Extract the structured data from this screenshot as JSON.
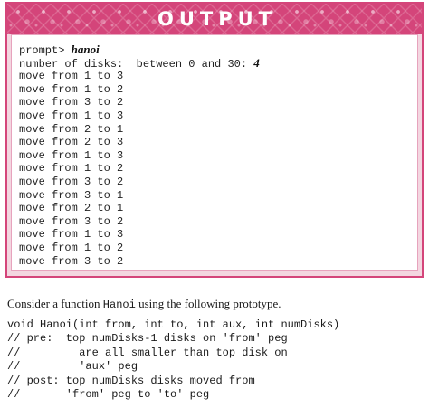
{
  "output": {
    "title": "OUTPUT",
    "prompt_line": {
      "prompt": "prompt> ",
      "command": "hanoi"
    },
    "disks_line": {
      "label": "number of disks:  between 0 and 30: ",
      "value": "4"
    },
    "moves": [
      "move from 1 to 3",
      "move from 1 to 2",
      "move from 3 to 2",
      "move from 1 to 3",
      "move from 2 to 1",
      "move from 2 to 3",
      "move from 1 to 3",
      "move from 1 to 2",
      "move from 3 to 2",
      "move from 3 to 1",
      "move from 2 to 1",
      "move from 3 to 2",
      "move from 1 to 3",
      "move from 1 to 2",
      "move from 3 to 2"
    ],
    "colors": {
      "frame": "#d4457a",
      "frame_tint": "#f3d6e0",
      "title_text": "#ffffff"
    }
  },
  "description": {
    "before": "Consider a function ",
    "function_name": "Hanoi",
    "after": " using the following prototype."
  },
  "code": [
    "void Hanoi(int from, int to, int aux, int numDisks)",
    "// pre:  top numDisks-1 disks on 'from' peg",
    "//         are all smaller than top disk on",
    "//         'aux' peg",
    "// post: top numDisks disks moved from",
    "//       'from' peg to 'to' peg"
  ]
}
